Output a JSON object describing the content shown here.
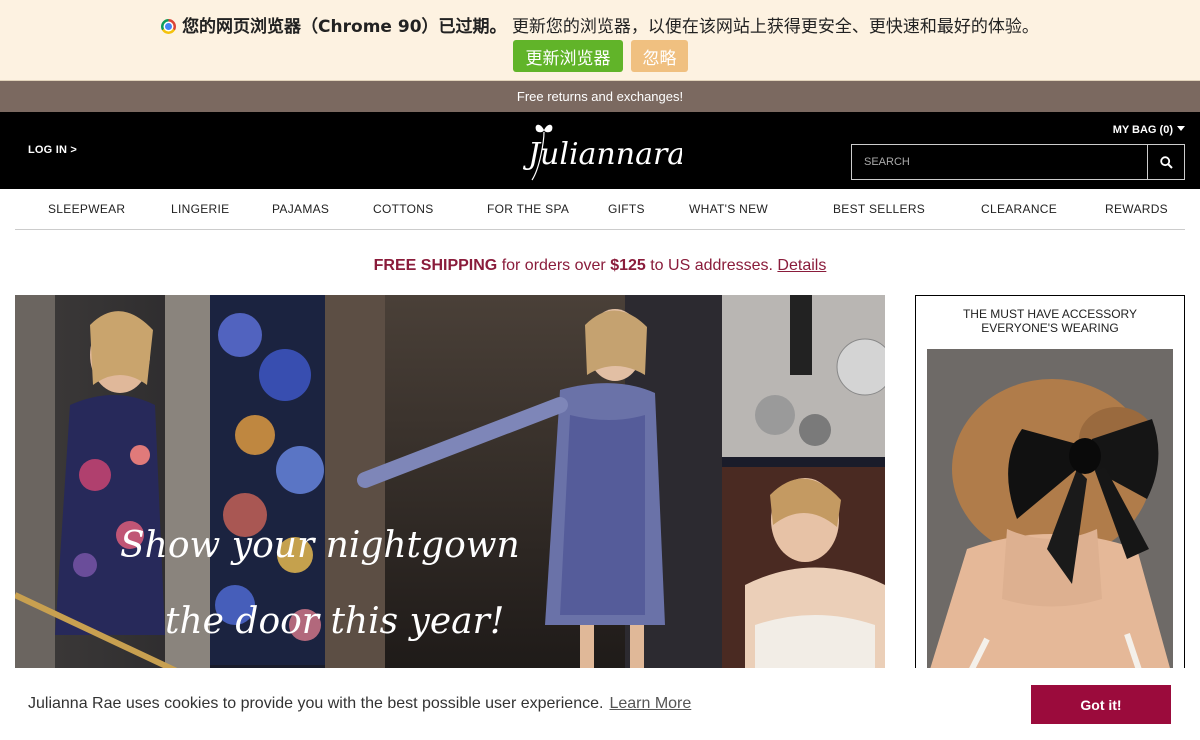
{
  "browser_update": {
    "title_bold": "您的网页浏览器（Chrome 90）已过期。",
    "message": "更新您的浏览器，以便在该网站上获得更安全、更快速和最好的体验。",
    "update_button": "更新浏览器",
    "ignore_button": "忽略"
  },
  "promo_bar": "Free returns and exchanges!",
  "header": {
    "login": "LOG IN >",
    "logo_text": "Juliannarae",
    "my_bag": "MY BAG (0)",
    "search_placeholder": "SEARCH"
  },
  "nav": {
    "items": [
      "SLEEPWEAR",
      "LINGERIE",
      "PAJAMAS",
      "COTTONS",
      "FOR THE SPA",
      "GIFTS",
      "WHAT'S NEW",
      "BEST SELLERS",
      "CLEARANCE",
      "REWARDS"
    ]
  },
  "shipping": {
    "bold": "FREE SHIPPING",
    "text1": "for orders over",
    "amount": "$125",
    "text2": "to US addresses.",
    "details": "Details"
  },
  "hero": {
    "script_line1": "Show your nightgown",
    "script_line2": "the door this year!"
  },
  "side_promo": {
    "title": "THE MUST HAVE ACCESSORY EVERYONE'S WEARING"
  },
  "cookie": {
    "message": "Julianna Rae uses cookies to provide you with the best possible user experience.",
    "learn_more": "Learn More",
    "button": "Got it!"
  },
  "colors": {
    "accent": "#8a1c3b",
    "cookie_button": "#9b0b3c",
    "update_button": "#61b429",
    "ignore_button": "#f0c080",
    "promo_bar": "#7b6960"
  }
}
